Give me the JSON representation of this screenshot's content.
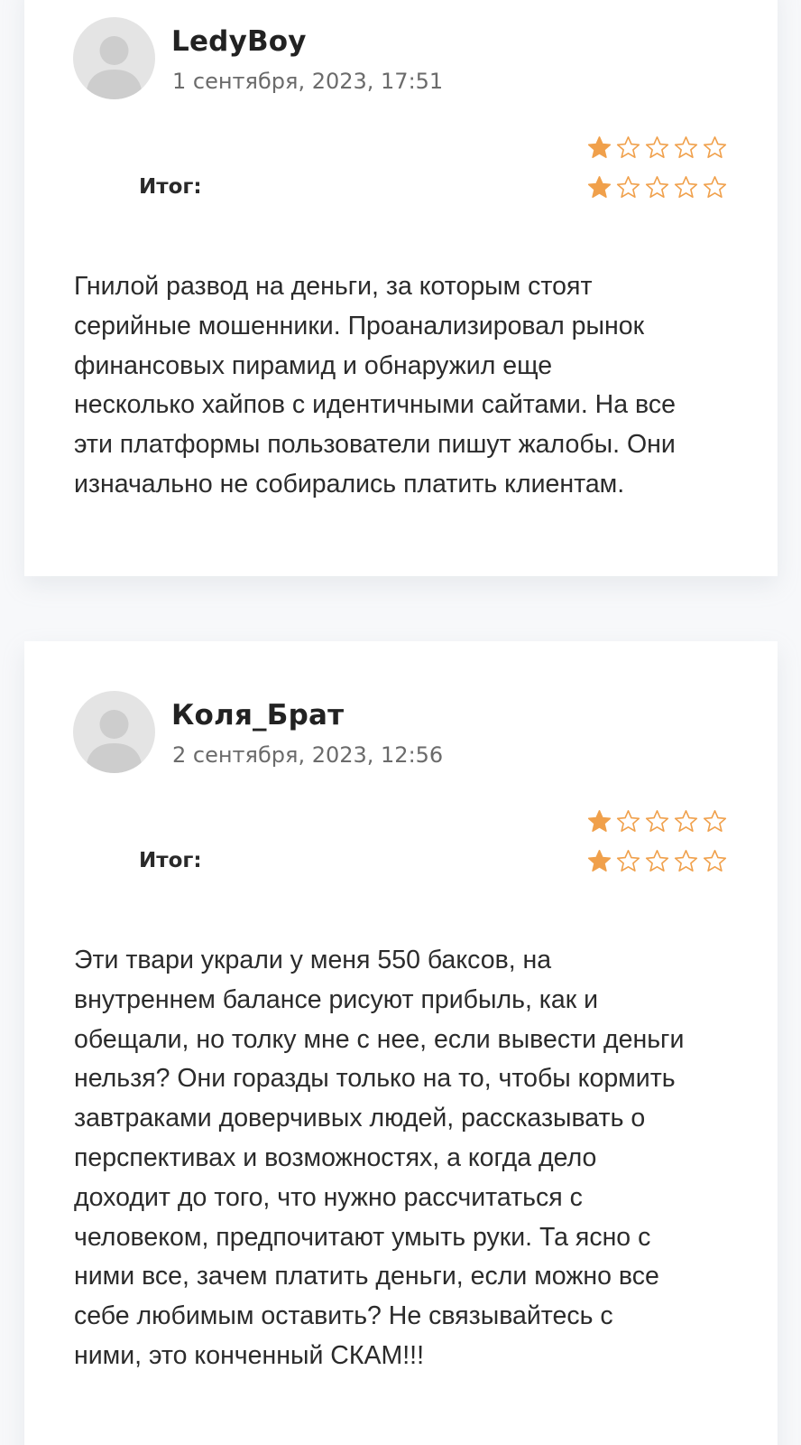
{
  "colors": {
    "star_fill": "#f0a04b",
    "star_outline": "#f0a04b",
    "avatar_bg": "#e4e4e4",
    "avatar_fg": "#cdcdcd"
  },
  "reviews": [
    {
      "author": "LedyBoy",
      "date": "1 сентября, 2023, 17:51",
      "rating_rows": [
        {
          "label": "",
          "stars": 1,
          "max": 5
        },
        {
          "label": "Итог:",
          "stars": 1,
          "max": 5
        }
      ],
      "text": "Гнилой развод на деньги, за которым стоят\nсерийные мошенники. Проанализировал рынок\nфинансовых пирамид и обнаружил еще\nнесколько хайпов с идентичными сайтами. На все\nэти платформы пользователи пишут жалобы. Они\nизначально не собирались платить клиентам."
    },
    {
      "author": "Коля_Брат",
      "date": "2 сентября, 2023, 12:56",
      "rating_rows": [
        {
          "label": "",
          "stars": 1,
          "max": 5
        },
        {
          "label": "Итог:",
          "stars": 1,
          "max": 5
        }
      ],
      "text": "Эти твари украли у меня 550 баксов, на\nвнутреннем балансе рисуют прибыль, как и\nобещали, но толку мне с нее, если вывести деньги\nнельзя? Они горазды только на то, чтобы кормить\nзавтраками доверчивых людей, рассказывать о\nперспективах и возможностях, а когда дело\nдоходит до того, что нужно рассчитаться с\nчеловеком, предпочитают умыть руки. Та ясно с\nними все, зачем платить деньги, если можно все\nсебе любимым оставить? Не связывайтесь с\nними, это конченный СКАМ!!!"
    }
  ]
}
